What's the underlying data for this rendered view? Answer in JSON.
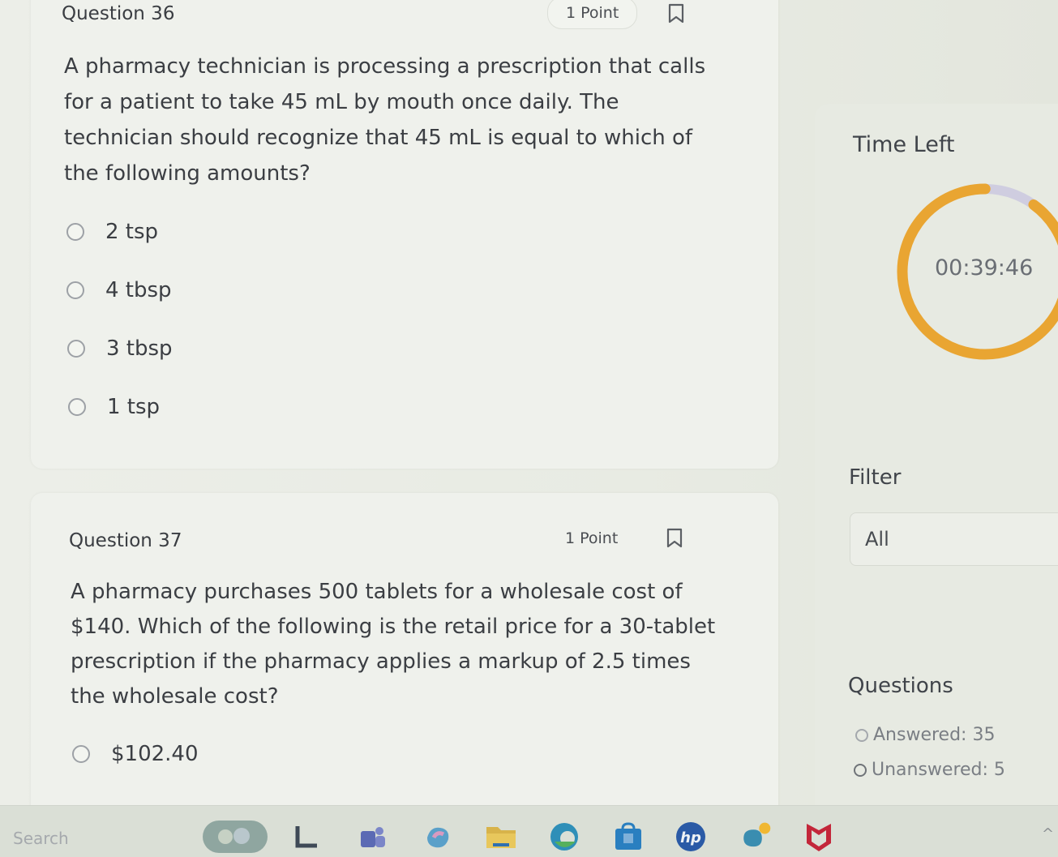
{
  "question36": {
    "title": "Question 36",
    "points": "1 Point",
    "text_lines": [
      "A pharmacy technician is processing a prescription that calls",
      "for a patient to take 45 mL by mouth once daily. The",
      "technician should recognize that 45 mL is equal to which of",
      "the following amounts?"
    ],
    "options": [
      "2 tsp",
      "4 tbsp",
      "3 tbsp",
      "1 tsp"
    ]
  },
  "question37": {
    "title": "Question 37",
    "points": "1 Point",
    "text_lines": [
      "A pharmacy purchases 500 tablets for a wholesale cost of",
      "$140. Which of the following is the retail price for a 30-tablet",
      "prescription if the pharmacy applies a markup of 2.5 times",
      "the wholesale cost?"
    ],
    "options": [
      "$102.40"
    ]
  },
  "sidebar": {
    "time_left_label": "Time Left",
    "timer_value": "00:39:46",
    "timer_remaining_fraction": 0.9,
    "filter_label": "Filter",
    "filter_value": "All",
    "questions_label": "Questions",
    "answered": "Answered: 35",
    "unanswered": "Unanswered: 5"
  },
  "taskbar": {
    "search_placeholder": "Search",
    "icons": [
      "weather-icon",
      "files-icon",
      "teams-icon",
      "copilot-icon",
      "file-explorer-icon",
      "edge-icon",
      "store-icon",
      "hp-icon",
      "app-icon",
      "mcafee-icon"
    ]
  },
  "colors": {
    "timer_arc": "#e9a532",
    "timer_track": "#cfcde0",
    "background": "#e9ebe4"
  }
}
